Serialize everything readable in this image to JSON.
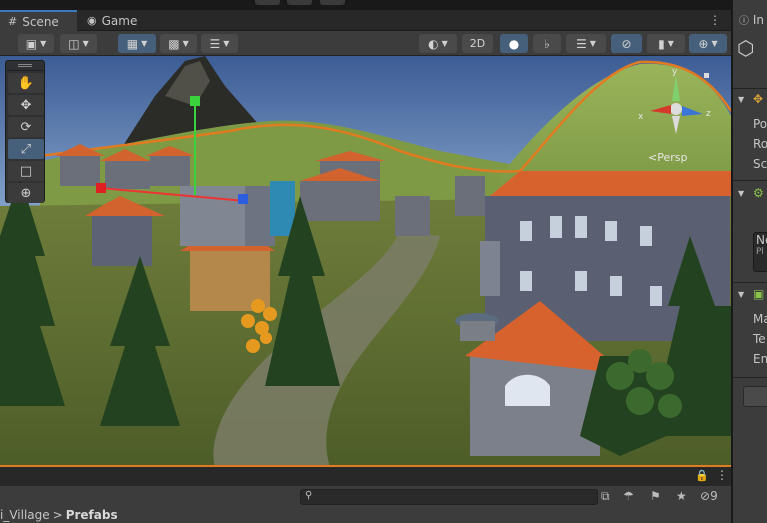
{
  "tabs": [
    {
      "label": "Scene",
      "icon": "grid-icon",
      "active": true
    },
    {
      "label": "Game",
      "icon": "gamepad-icon",
      "active": false
    }
  ],
  "toolbar": {
    "left": [
      {
        "name": "draw-mode",
        "icon": "shaded-icon"
      },
      {
        "name": "render-mode",
        "icon": "cube-icon"
      },
      {
        "name": "grid-snap",
        "icon": "grid-snap-icon"
      },
      {
        "name": "increment-snap",
        "icon": "snap-increment-icon"
      },
      {
        "name": "align",
        "icon": "ruler-icon"
      }
    ],
    "right": [
      {
        "name": "shading",
        "icon": "sphere-icon"
      },
      {
        "name": "toggle-2d",
        "label": "2D"
      },
      {
        "name": "lighting",
        "icon": "bulb-icon"
      },
      {
        "name": "audio",
        "icon": "mute-icon"
      },
      {
        "name": "effects",
        "icon": "layers-icon"
      },
      {
        "name": "hidden-objects",
        "icon": "eye-slash-icon"
      },
      {
        "name": "camera",
        "icon": "camera-icon"
      },
      {
        "name": "gizmos",
        "icon": "gizmo-icon"
      }
    ],
    "label_2d": "2D"
  },
  "tools": [
    {
      "name": "hand-tool",
      "icon": "hand-icon",
      "selected": false
    },
    {
      "name": "move-tool",
      "icon": "move-icon",
      "selected": false
    },
    {
      "name": "rotate-tool",
      "icon": "rotate-icon",
      "selected": false
    },
    {
      "name": "scale-tool",
      "icon": "scale-icon",
      "selected": true
    },
    {
      "name": "rect-tool",
      "icon": "rect-icon",
      "selected": false
    },
    {
      "name": "transform-tool",
      "icon": "transform-icon",
      "selected": false
    }
  ],
  "gizmo": {
    "persp_label": "<Persp",
    "x": "x",
    "y": "y",
    "z": "z"
  },
  "inspector": {
    "tab": "In",
    "rows": [
      {
        "label": "Po"
      },
      {
        "label": "Ro"
      },
      {
        "label": "Sc"
      },
      {
        "label": "Ne"
      },
      {
        "label": "Pl"
      },
      {
        "label": "Ma"
      },
      {
        "label": "Te"
      },
      {
        "label": "Ena"
      }
    ]
  },
  "project": {
    "search_placeholder": "",
    "breadcrumb": [
      "i_Village",
      "Prefabs"
    ],
    "hidden_count": "9"
  },
  "colors": {
    "selection_outline": "#e07b22",
    "active_blue": "#46607c",
    "panel": "#3c3c3c"
  }
}
